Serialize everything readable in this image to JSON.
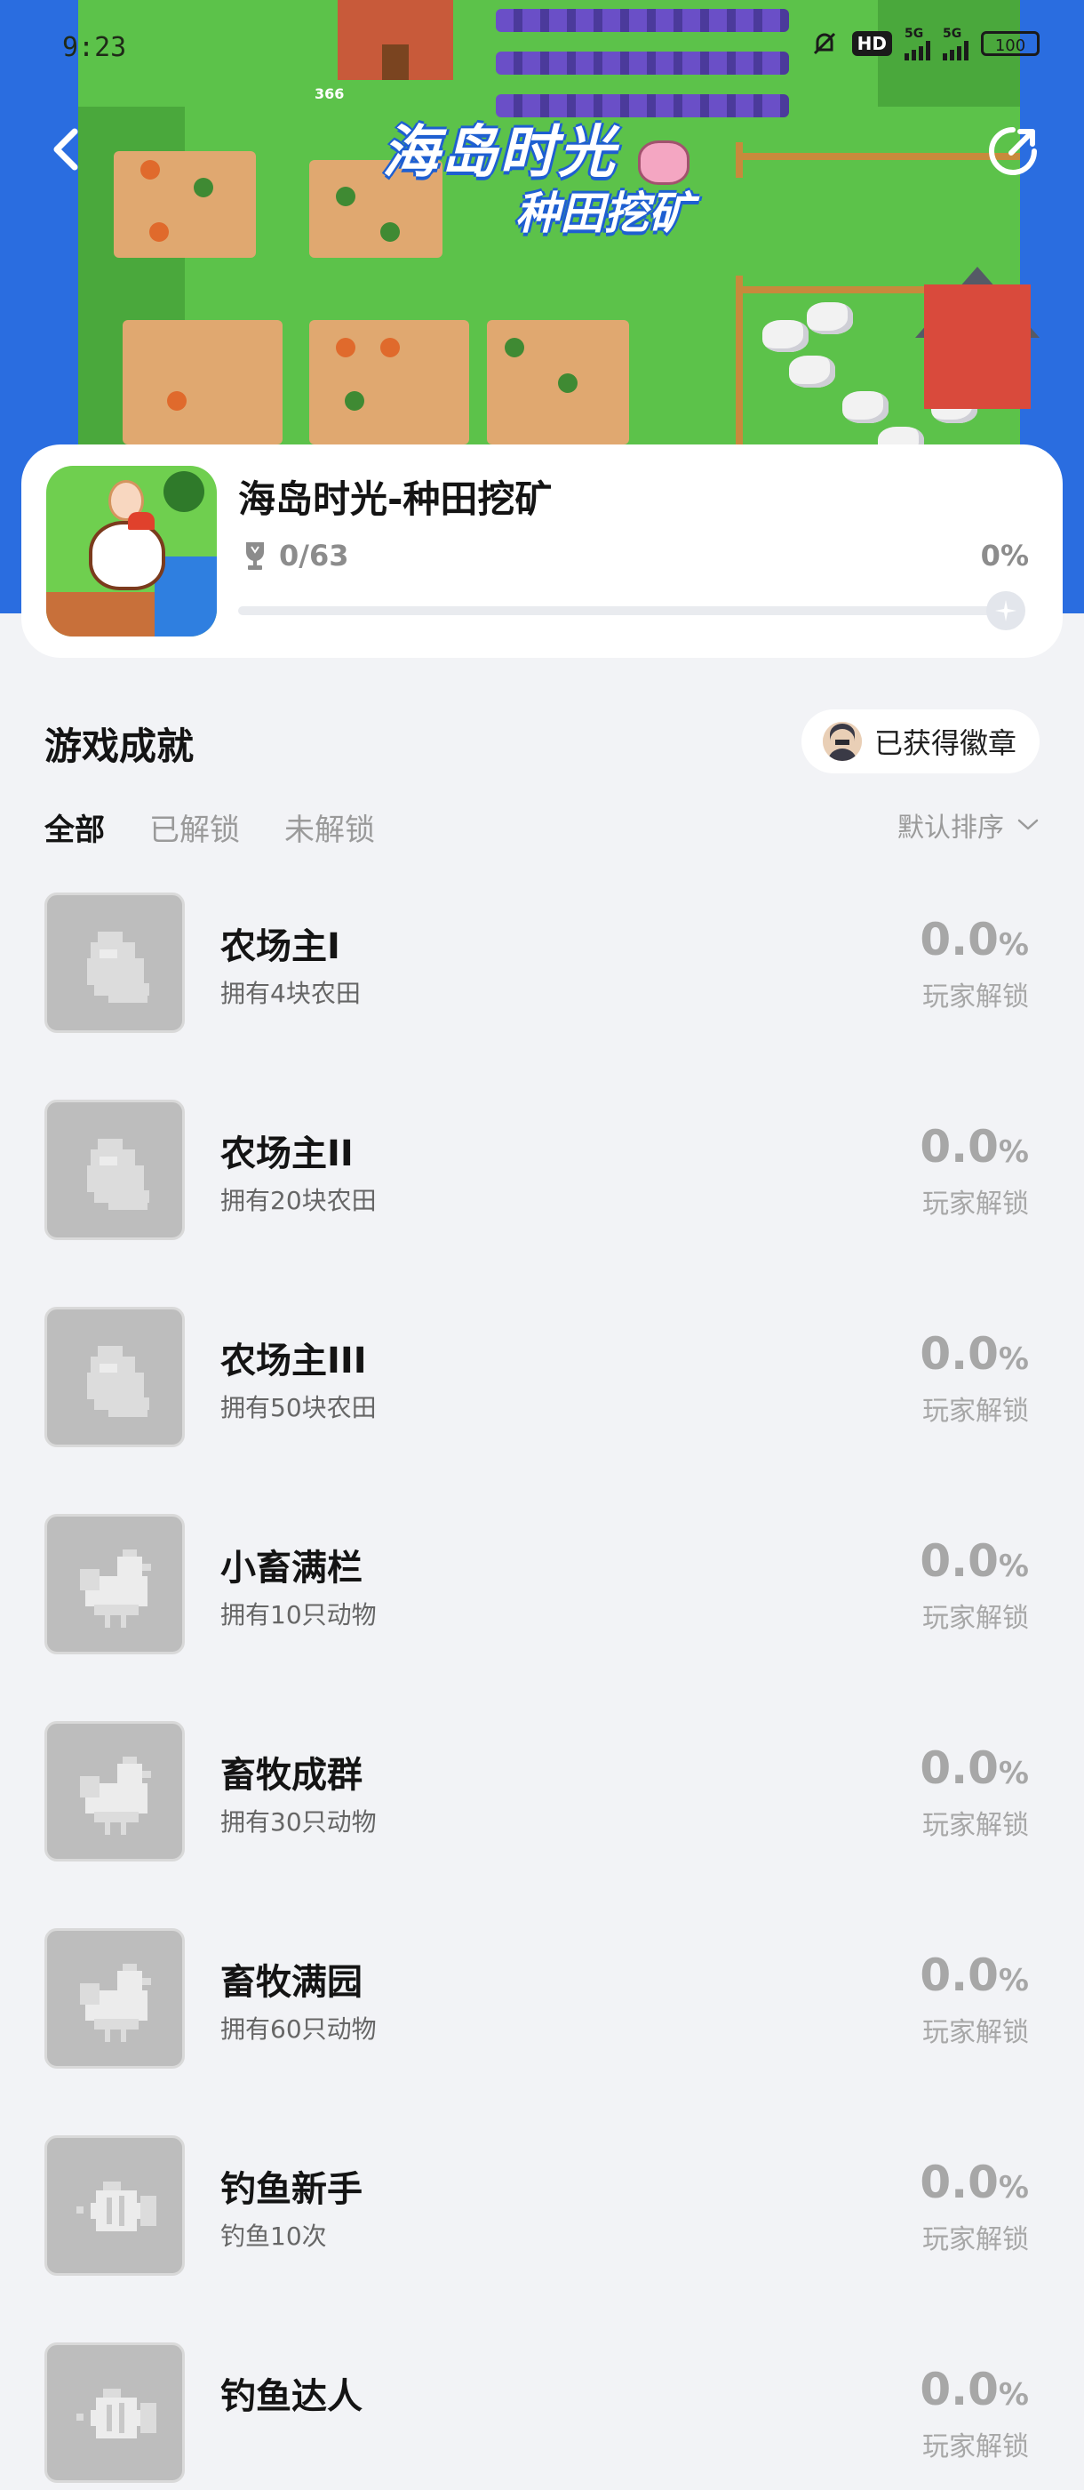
{
  "status_bar": {
    "time": "9:23",
    "hd_label": "HD",
    "network_1": "5G",
    "network_2": "5G",
    "battery": "100"
  },
  "hero": {
    "title": "海岛时光",
    "subtitle": "种田挖矿",
    "sign_number": "366"
  },
  "nav": {
    "back_icon": "chevron-left-icon",
    "share_icon": "share-icon"
  },
  "game": {
    "name": "海岛时光-种田挖矿",
    "trophy_progress": "0/63",
    "percent_text": "0%",
    "progress_fraction": 0
  },
  "section": {
    "title": "游戏成就",
    "badge_button": "已获得徽章"
  },
  "tabs": [
    {
      "label": "全部",
      "active": true
    },
    {
      "label": "已解锁",
      "active": false
    },
    {
      "label": "未解锁",
      "active": false
    }
  ],
  "sort": {
    "label": "默认排序"
  },
  "unlock_label": "玩家解锁",
  "achievements": [
    {
      "name": "农场主I",
      "desc": "拥有4块农田",
      "percent": "0.0",
      "unit": "%",
      "icon": "bag-icon"
    },
    {
      "name": "农场主II",
      "desc": "拥有20块农田",
      "percent": "0.0",
      "unit": "%",
      "icon": "bag-icon"
    },
    {
      "name": "农场主III",
      "desc": "拥有50块农田",
      "percent": "0.0",
      "unit": "%",
      "icon": "bag-icon"
    },
    {
      "name": "小畜满栏",
      "desc": "拥有10只动物",
      "percent": "0.0",
      "unit": "%",
      "icon": "chicken-icon"
    },
    {
      "name": "畜牧成群",
      "desc": "拥有30只动物",
      "percent": "0.0",
      "unit": "%",
      "icon": "chicken-icon"
    },
    {
      "name": "畜牧满园",
      "desc": "拥有60只动物",
      "percent": "0.0",
      "unit": "%",
      "icon": "chicken-icon"
    },
    {
      "name": "钓鱼新手",
      "desc": "钓鱼10次",
      "percent": "0.0",
      "unit": "%",
      "icon": "fish-icon"
    },
    {
      "name": "钓鱼达人",
      "desc": "",
      "percent": "0.0",
      "unit": "%",
      "icon": "fish-icon"
    }
  ],
  "colors": {
    "hero_blue": "#2a6de0",
    "grass": "#5cc24a",
    "page_bg": "#f2f3f6",
    "muted_text": "#a7a7a7"
  }
}
